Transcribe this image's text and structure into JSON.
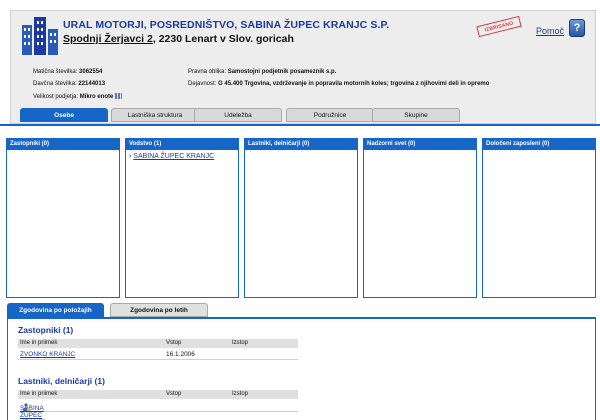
{
  "header": {
    "company_name": "URAL MOTORJI, POSREDNIŠTVO, SABINA ŽUPEC KRANJC S.P.",
    "street": "Spodnji Žerjavci 2",
    "postal_city": ", 2230 Lenart v Slov. goricah",
    "stamp_text": "IZBRISANO",
    "help_label": "Pomoč",
    "help_icon_text": "?"
  },
  "info": {
    "maticna_label": "Matična številka:",
    "maticna_value": "3062554",
    "davcna_label": "Davčna številka:",
    "davcna_value": "22144013",
    "velikost_label": "Velikost podjetja:",
    "velikost_value": "Mikro enote",
    "pravna_label": "Pravna oblika:",
    "pravna_value": "Samostojni podjetnik posameznik s.p.",
    "dejavnost_label": "Dejavnost:",
    "dejavnost_value": "G 45.400 Trgovina, vzdrževanje in popravila motornih koles; trgovina z njihovimi deli in opremo"
  },
  "tabs": [
    "Osebe",
    "Lastniška struktura",
    "Udeležba",
    "Podružnice",
    "Skupine"
  ],
  "panels": [
    {
      "title": "Zastopniki (0)",
      "items": []
    },
    {
      "title": "Vodstvo (1)",
      "items": [
        "SABINA ŽUPEC KRANJC"
      ]
    },
    {
      "title": "Lastniki, delničarji (0)",
      "items": []
    },
    {
      "title": "Nadzorni svet (0)",
      "items": []
    },
    {
      "title": "Določeni zaposleni (0)",
      "items": []
    }
  ],
  "history_tabs": [
    "Zgodovina po položajih",
    "Zgodovina po letih"
  ],
  "history": {
    "sections": [
      {
        "title": "Zastopniki (1)",
        "columns": [
          "Ime in priimek",
          "Vstop",
          "Izstop"
        ],
        "rows": [
          [
            "ZVONKO KRANJC",
            "16.1.2006",
            ""
          ]
        ]
      },
      {
        "title": "Lastniki, delničarji (1)",
        "columns": [
          "Ime in priimek",
          "Vstop",
          "Izstop"
        ],
        "rows": [
          [
            "SABINA ŽUPEC KRANJC",
            "",
            ""
          ]
        ]
      }
    ]
  },
  "colors": {
    "accent": "#1666c8",
    "link": "#1a3aa0",
    "stamp": "#d43a3a",
    "header_bg": "#ededed"
  },
  "icons": [
    "company-buildings-icon",
    "help-icon",
    "company-size-icon",
    "person-icon",
    "arrow-icon"
  ]
}
